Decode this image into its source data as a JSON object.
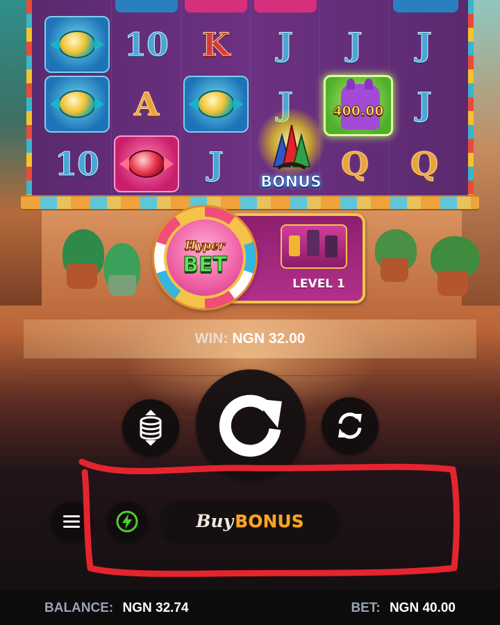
{
  "reels": {
    "symbols": {
      "row1": [
        "candy",
        "10",
        "K",
        "J",
        "J",
        "J"
      ],
      "row2": [
        "candy",
        "A",
        "candy",
        "J",
        "llama",
        "J"
      ],
      "row3": [
        "10",
        "pink-candy",
        "J",
        "bonus",
        "Q",
        "Q"
      ]
    },
    "llama_value": "400.00",
    "bonus_label": "BONUS"
  },
  "hyper_bet": {
    "word1": "Hyper",
    "word2": "BET",
    "level_label": "LEVEL 1"
  },
  "win": {
    "label": "WIN:",
    "value": "NGN 32.00"
  },
  "controls": {
    "spin_icon": "spin-arrow-icon",
    "stake_icon": "coin-stack-icon",
    "autoplay_icon": "autoplay-refresh-icon",
    "menu_icon": "hamburger-menu-icon",
    "turbo_icon": "lightning-icon",
    "buy_bonus": {
      "buy": "Buy",
      "bonus": "BONUS"
    }
  },
  "status": {
    "balance_label": "BALANCE:",
    "balance_value": "NGN 32.74",
    "bet_label": "BET:",
    "bet_value": "NGN 40.00"
  },
  "colors": {
    "annotation": "#e4252d",
    "turbo_green": "#4dd12b",
    "bonus_orange": "#f5a623"
  }
}
